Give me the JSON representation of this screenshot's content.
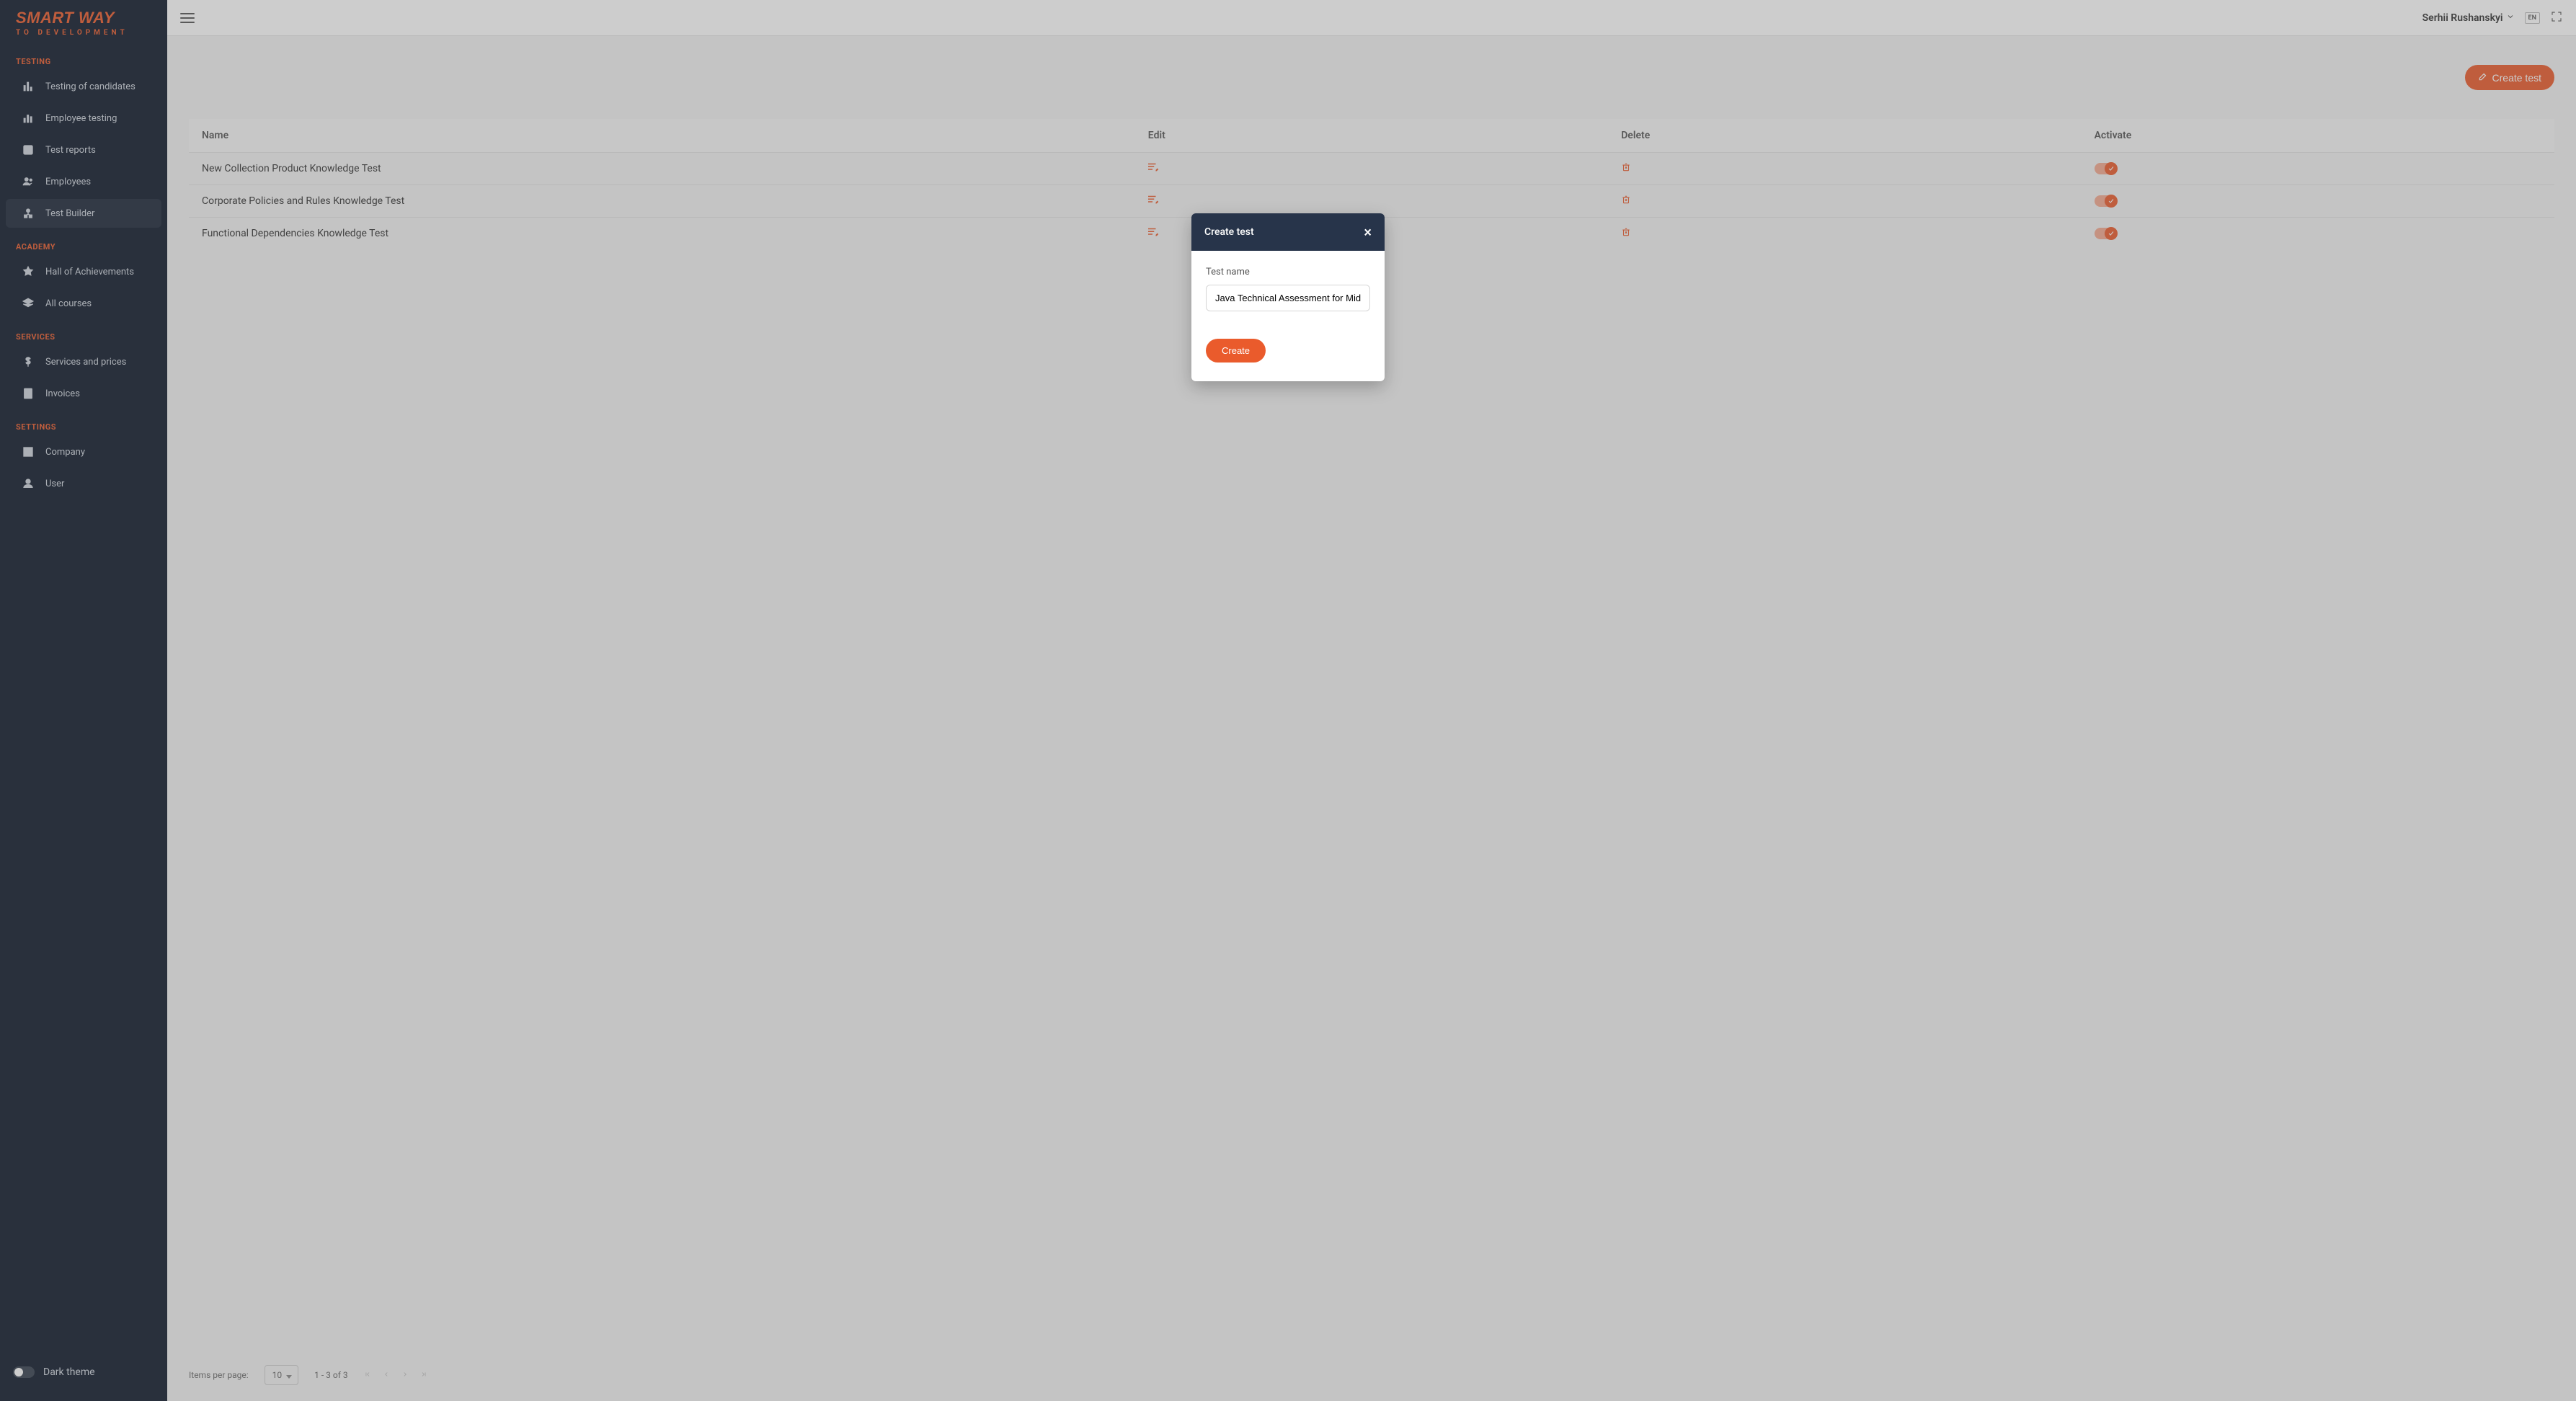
{
  "logo": {
    "line1": "SMART WAY",
    "line2": "TO DEVELOPMENT"
  },
  "sidebar": {
    "sections": {
      "testing": {
        "title": "TESTING",
        "items": [
          {
            "label": "Testing of candidates"
          },
          {
            "label": "Employee testing"
          },
          {
            "label": "Test reports"
          },
          {
            "label": "Employees"
          },
          {
            "label": "Test Builder"
          }
        ]
      },
      "academy": {
        "title": "ACADEMY",
        "items": [
          {
            "label": "Hall of Achievements"
          },
          {
            "label": "All courses"
          }
        ]
      },
      "services": {
        "title": "SERVICES",
        "items": [
          {
            "label": "Services and prices"
          },
          {
            "label": "Invoices"
          }
        ]
      },
      "settings": {
        "title": "SETTINGS",
        "items": [
          {
            "label": "Company"
          },
          {
            "label": "User"
          }
        ]
      }
    },
    "dark_theme_label": "Dark theme"
  },
  "header": {
    "user_name": "Serhii Rushanskyi",
    "lang": "EN"
  },
  "toolbar": {
    "create_test": "Create test"
  },
  "table": {
    "columns": {
      "name": "Name",
      "edit": "Edit",
      "delete": "Delete",
      "activate": "Activate"
    },
    "rows": [
      {
        "name": "New Collection Product Knowledge Test"
      },
      {
        "name": "Corporate Policies and Rules Knowledge Test"
      },
      {
        "name": "Functional Dependencies Knowledge Test"
      }
    ]
  },
  "paginator": {
    "items_per_page_label": "Items per page:",
    "page_size": "10",
    "range": "1 - 3 of 3"
  },
  "modal": {
    "title": "Create test",
    "field_label": "Test name",
    "input_value": "Java Technical Assessment for Mid-Level Developers",
    "create_button": "Create"
  }
}
